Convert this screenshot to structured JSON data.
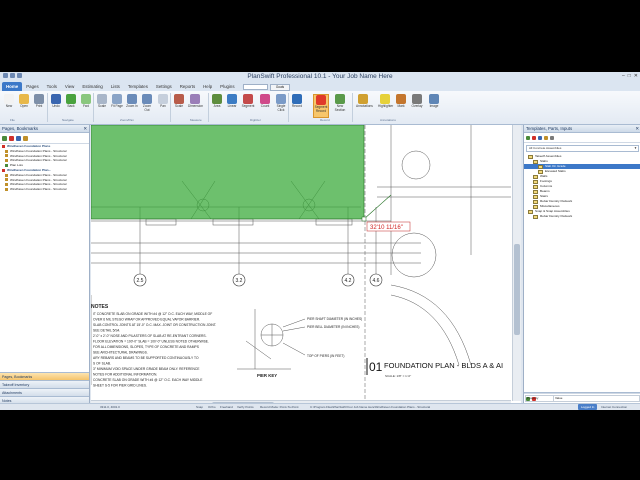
{
  "window": {
    "title": "PlanSwift Professional 10.1 - Your Job Name Here",
    "controls": [
      "–",
      "□",
      "✕"
    ]
  },
  "tabs": [
    "Home",
    "Pages",
    "Tools",
    "View",
    "Estimating",
    "Lists",
    "Templates",
    "Settings",
    "Reports",
    "Help",
    "Plugins",
    "Need Work?"
  ],
  "search": {
    "button": "Goals"
  },
  "ribbon": {
    "buttons": [
      {
        "label": "New",
        "icon": "new-icon",
        "color": "#f2f2f2"
      },
      {
        "label": "Open",
        "icon": "open-icon",
        "color": "#e8b84a"
      },
      {
        "label": "Print",
        "icon": "print-icon",
        "color": "#7e8fa8"
      },
      {
        "label": "Undo",
        "icon": "undo-icon",
        "color": "#3a66b0"
      },
      {
        "label": "Back",
        "icon": "back-icon",
        "color": "#49a23e"
      },
      {
        "label": "Fwd",
        "icon": "forward-icon",
        "color": "#8ac77e"
      },
      {
        "label": "Scale",
        "icon": "scale-icon",
        "color": "#a9b6c9"
      },
      {
        "label": "Fit Page",
        "icon": "fit-page-icon",
        "color": "#8aa4c7"
      },
      {
        "label": "Zoom In",
        "icon": "zoom-in-icon",
        "color": "#6a8bb9"
      },
      {
        "label": "Zoom Out",
        "icon": "zoom-out-icon",
        "color": "#6a8bb9"
      },
      {
        "label": "Pan",
        "icon": "pan-icon",
        "color": "#c6cfdc"
      },
      {
        "label": "Scale",
        "icon": "scale-tool-icon",
        "color": "#b85c4a"
      },
      {
        "label": "Dimension",
        "icon": "dimension-icon",
        "color": "#9a7eb8"
      },
      {
        "label": "Area",
        "icon": "area-icon",
        "color": "#5e8d3e"
      },
      {
        "label": "Linear",
        "icon": "linear-icon",
        "color": "#3c7cc4"
      },
      {
        "label": "Segment",
        "icon": "segment-icon",
        "color": "#c44a4a"
      },
      {
        "label": "Count",
        "icon": "count-icon",
        "color": "#d04a8a"
      },
      {
        "label": "Single Click",
        "icon": "single-click-icon",
        "color": "#7a9ac7"
      },
      {
        "label": "Record",
        "icon": "record-icon",
        "color": "#2f6db8"
      },
      {
        "label": "Segment Record",
        "icon": "segment-record-icon",
        "color": "#e03a2a"
      },
      {
        "label": "New Section",
        "icon": "new-section-icon",
        "color": "#5a9a4a"
      },
      {
        "label": "Annotations",
        "icon": "annotations-icon",
        "color": "#d0a030"
      },
      {
        "label": "Highlighter",
        "icon": "highlighter-icon",
        "color": "#e6d13a"
      },
      {
        "label": "Mark",
        "icon": "mark-icon",
        "color": "#c4762e"
      },
      {
        "label": "Overlay",
        "icon": "overlay-icon",
        "color": "#7a7a7a"
      },
      {
        "label": "Image",
        "icon": "image-icon",
        "color": "#5f86b6"
      }
    ],
    "groups": [
      "File",
      "Navigate",
      "Zoom/Pan",
      "Measure",
      "Digitizer",
      "Record",
      "Annotations"
    ]
  },
  "left_panel": {
    "header": "Pages, Bookmarks",
    "tree": [
      {
        "label": "Windhaven Foundation Plans",
        "bold": true,
        "color": "#d0302a"
      },
      {
        "label": "Windhaven Foundation Plans - Structural",
        "bold": false,
        "color": "#c0902a"
      },
      {
        "label": "Windhaven Foundation Plans - Structural",
        "bold": false,
        "color": "#c0902a"
      },
      {
        "label": "Windhaven Foundation Plans - Structural",
        "bold": false,
        "color": "#c0902a"
      },
      {
        "label": "Plan Lots",
        "bold": false,
        "color": "#4a8a3a"
      },
      {
        "label": "Windhaven Foundation Plan...",
        "bold": true,
        "color": "#d0302a"
      },
      {
        "label": "Windhaven Foundation Plans - Structural",
        "bold": false,
        "color": "#c0902a"
      },
      {
        "label": "Windhaven Foundation Plans - Structural",
        "bold": false,
        "color": "#c0902a"
      },
      {
        "label": "Windhaven Foundation Plans - Structural",
        "bold": false,
        "color": "#c0902a"
      },
      {
        "label": "Windhaven Foundation Plans - Structural",
        "bold": false,
        "color": "#c0902a"
      }
    ],
    "accordion": [
      "Pages, Bookmarks",
      "Takeoff Inventory",
      "Attachments",
      "Notes"
    ]
  },
  "drawing": {
    "grid_labels": [
      "2.5",
      "3.2",
      "4.2",
      "4.6"
    ],
    "dimension_callout": "32'10 11/16\"",
    "notes_heading": "NOTES",
    "note_lines": [
      "IT CONCRETE SLAB ON GRADE WITH #4 @ 12\" O.C. EACH WAY, MIDDLE OF",
      "OVER 6 MIL STEGO WRAP OR APPROVED EQUAL VAPOR BARRIER.",
      "SLAB CONTROL JOINTS AT 15'-0\" O.C. MAX. JOINT OR CONSTRUCTION JOINT.",
      "SEE DETAIL 5/S4.",
      "2'-0\" x 2'-0\" NOSE AND PILASTERS OF SLAB AT RE-ENTRANT CORNERS.",
      "FLOOR ELEVATION = 100'-0\" SLAB = 100'-0\" UNLESS NOTED OTHERWISE.",
      "FOR ALL DIMENSIONS, SLOPES, TYPE OF CONCRETE AND RAMPS",
      "SEE ARCHITECTURAL DRAWINGS.",
      "ARY REBARS AND BEAMS TO BE SUPPORTED CONTINUOUSLY TO",
      "S OF SLAB.",
      "3\" MINIMUM VOID SPACE UNDER GRADE BEAM ONLY. REFERENCE",
      "NOTES FOR ADDITIONAL INFORMATION.",
      "CONCRETE SLAB ON GRADE WITH #4 @ 12\" O.C. EACH WAY MIDDLE",
      "SHEET S-5 FOR PIER GRID LINES."
    ],
    "pier_callouts": [
      "PIER SHAFT DIAMETER (IN INCHES)",
      "PIER BELL DIAMETER (IN INCHES)",
      "TOP OF PIERS (IN FEET)"
    ],
    "pier_key_label": "PIER KEY",
    "plan_number": "01",
    "plan_title": "FOUNDATION PLAN - BLDS A & AI",
    "plan_scale": "SCALE: 1/8\" = 1'-0\"",
    "area_color": "#35a835"
  },
  "right_panel": {
    "header": "Templates, Parts, Inputs",
    "dropdown": "All Concrete Assemblies",
    "tree": [
      {
        "label": "Takeoff Assemblies",
        "indent": 0
      },
      {
        "label": "Slabs",
        "indent": 1
      },
      {
        "label": "Slab On Grade",
        "indent": 2,
        "selected": true
      },
      {
        "label": "Elevated Slabs",
        "indent": 2
      },
      {
        "label": "Walls",
        "indent": 1
      },
      {
        "label": "Footings",
        "indent": 1
      },
      {
        "label": "Columns",
        "indent": 1
      },
      {
        "label": "Beams",
        "indent": 1
      },
      {
        "label": "Stairs",
        "indent": 1
      },
      {
        "label": "Rebar Density Flatwork",
        "indent": 1
      },
      {
        "label": "Miscellaneous",
        "indent": 1
      },
      {
        "label": "Snap & Snap Assemblies",
        "indent": 0
      },
      {
        "label": "Rebar Density Flatwork",
        "indent": 1
      }
    ],
    "property_header": "Property",
    "value_header": "Value"
  },
  "status_bar": {
    "left": "3311.0, 4001.0",
    "items": [
      "Snap",
      "Ortho",
      "Freehand",
      "Verify Points",
      "Record Mode: Point-To-Point",
      "C:\\Program Files\\PlanSwift\\Your Job Name Here\\Windhaven Foundation Plans - Structural"
    ],
    "pill": "Logged In",
    "right": "Internet Connection"
  }
}
